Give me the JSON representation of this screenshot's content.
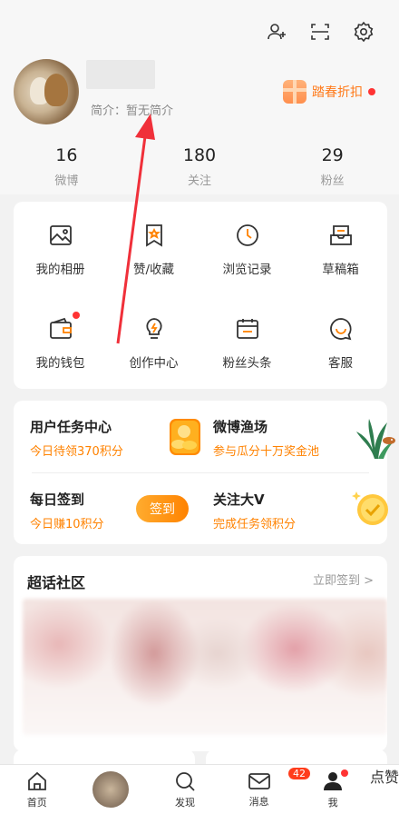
{
  "profile": {
    "bio": "简介：暂无简介",
    "promo": "踏春折扣"
  },
  "stats": [
    {
      "num": "16",
      "label": "微博"
    },
    {
      "num": "180",
      "label": "关注"
    },
    {
      "num": "29",
      "label": "粉丝"
    }
  ],
  "grid": [
    "我的相册",
    "赞/收藏",
    "浏览记录",
    "草稿箱",
    "我的钱包",
    "创作中心",
    "粉丝头条",
    "客服"
  ],
  "tasks": {
    "t1_title": "用户任务中心",
    "t1_sub": "今日待领370积分",
    "t2_title": "微博渔场",
    "t2_sub": "参与瓜分十万奖金池",
    "t3_title": "每日签到",
    "t3_sub": "今日赚10积分",
    "sign_btn": "签到",
    "t4_title": "关注大V",
    "t4_sub": "完成任务领积分"
  },
  "super": {
    "title": "超话社区",
    "action": "立即签到 >"
  },
  "tabbar": {
    "home": "首页",
    "discover": "发现",
    "messages": "消息",
    "me": "我",
    "like_badge": "点赞",
    "msg_count": "42"
  },
  "colors": {
    "accent": "#ff8200",
    "badge": "#ff3d1c",
    "arrow": "#f0303a"
  }
}
